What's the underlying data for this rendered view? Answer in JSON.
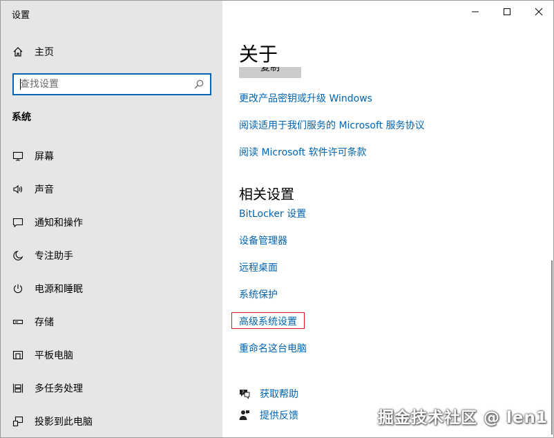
{
  "window": {
    "title": "设置"
  },
  "sidebar": {
    "home_label": "主页",
    "search": {
      "placeholder": "查找设置",
      "value": ""
    },
    "section_title": "系统",
    "items": [
      {
        "label": "屏幕",
        "icon": "monitor-icon"
      },
      {
        "label": "声音",
        "icon": "speaker-icon"
      },
      {
        "label": "通知和操作",
        "icon": "notification-icon"
      },
      {
        "label": "专注助手",
        "icon": "moon-icon"
      },
      {
        "label": "电源和睡眠",
        "icon": "power-icon"
      },
      {
        "label": "存储",
        "icon": "storage-icon"
      },
      {
        "label": "平板电脑",
        "icon": "tablet-icon"
      },
      {
        "label": "多任务处理",
        "icon": "multitask-icon"
      },
      {
        "label": "投影到此电脑",
        "icon": "project-icon"
      }
    ]
  },
  "content": {
    "page_title": "关于",
    "copy_button": "复制",
    "links_top": [
      "更改产品密钥或升级 Windows",
      "阅读适用于我们服务的 Microsoft 服务协议",
      "阅读 Microsoft 软件许可条款"
    ],
    "related_title": "相关设置",
    "related_links": [
      "BitLocker 设置",
      "设备管理器",
      "远程桌面",
      "系统保护",
      "高级系统设置",
      "重命名这台电脑"
    ],
    "help": [
      {
        "label": "获取帮助",
        "icon": "help-chat-icon"
      },
      {
        "label": "提供反馈",
        "icon": "feedback-icon"
      }
    ]
  },
  "colors": {
    "accent": "#0063b1",
    "sidebar_bg": "#e6e6e6",
    "highlight": "#e0131d"
  },
  "watermark": "掘金技术社区 @ len1"
}
